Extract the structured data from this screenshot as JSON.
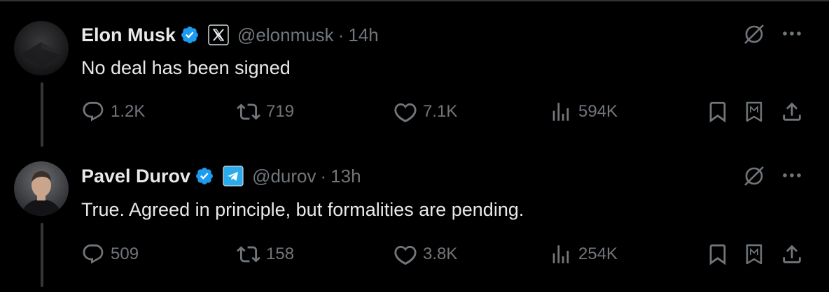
{
  "tweets": [
    {
      "name": "Elon Musk",
      "verified": true,
      "affiliate_icon": "x-logo-icon",
      "handle": "@elonmusk",
      "separator": "·",
      "time": "14h",
      "text": "No deal has been signed",
      "metrics": {
        "replies": "1.2K",
        "reposts": "719",
        "likes": "7.1K",
        "views": "594K"
      }
    },
    {
      "name": "Pavel Durov",
      "verified": true,
      "affiliate_icon": "telegram-logo-icon",
      "handle": "@durov",
      "separator": "·",
      "time": "13h",
      "text": "True. Agreed in principle, but formalities are pending.",
      "metrics": {
        "replies": "509",
        "reposts": "158",
        "likes": "3.8K",
        "views": "254K"
      }
    }
  ],
  "icons": {
    "reply": "reply-icon",
    "repost": "repost-icon",
    "like": "like-icon",
    "views": "views-icon",
    "bookmark": "bookmark-icon",
    "mirror": "mirror-icon",
    "share": "share-icon",
    "grok": "grok-icon",
    "more": "more-icon"
  },
  "colors": {
    "background": "#000000",
    "text": "#e7e9ea",
    "muted": "#71767b",
    "verified_blue": "#1d9bf0",
    "telegram_blue": "#2aabee",
    "divider": "#2f3336"
  }
}
